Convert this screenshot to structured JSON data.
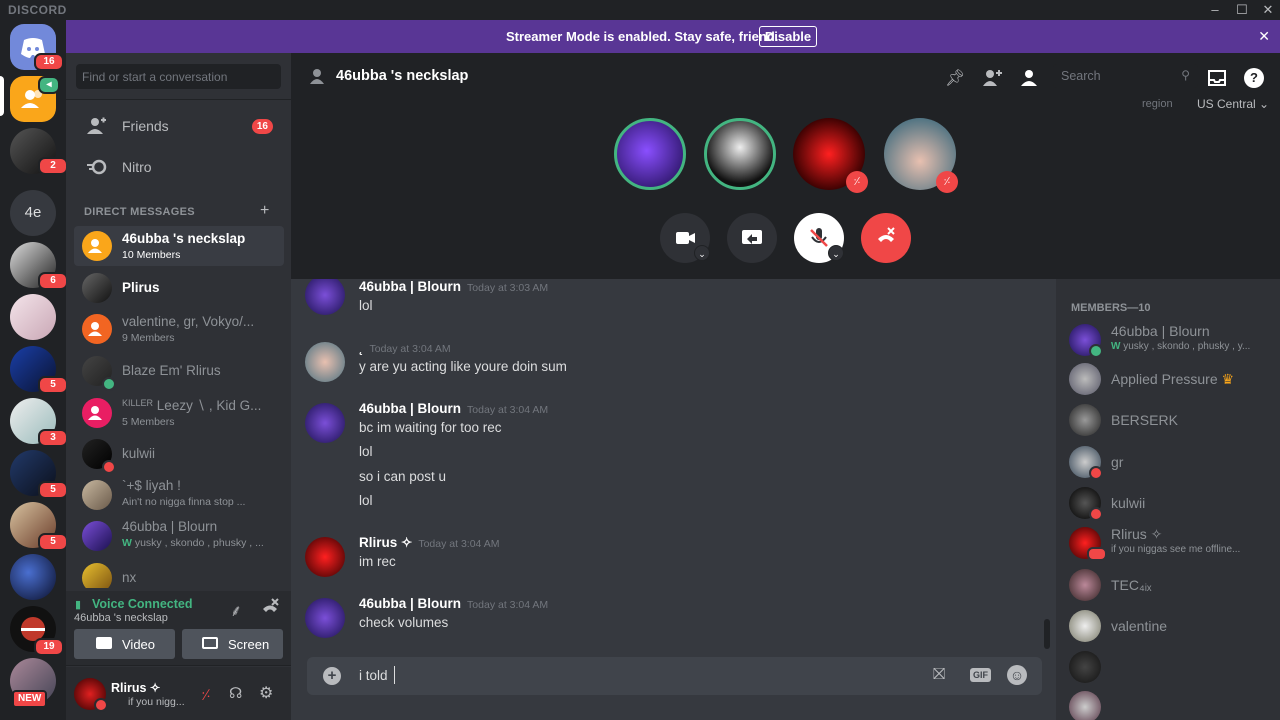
{
  "app": {
    "title": "DISCORD"
  },
  "window": {
    "min": "–",
    "max": "☐",
    "close": "✕"
  },
  "banner": {
    "text": "Streamer Mode is enabled. Stay safe, friend.",
    "button": "Disable",
    "close": "✕"
  },
  "guilds": {
    "items": [
      {
        "badge": "16"
      },
      {
        "badge": ""
      },
      {
        "badge": "2"
      },
      {
        "label": "4e",
        "badge": ""
      },
      {
        "badge": "6"
      },
      {
        "badge": ""
      },
      {
        "badge": "5"
      },
      {
        "badge": "3"
      },
      {
        "badge": "5"
      },
      {
        "badge": "5"
      },
      {
        "badge": ""
      },
      {
        "badge": "19"
      },
      {
        "badge": "NEW"
      }
    ]
  },
  "sidebar": {
    "search_placeholder": "Find or start a conversation",
    "friends": {
      "label": "Friends",
      "badge": "16"
    },
    "nitro": {
      "label": "Nitro"
    },
    "dm_header": "DIRECT MESSAGES",
    "dms": [
      {
        "name": "46ubba 's neckslap",
        "sub": "10 Members"
      },
      {
        "name": "Plirus",
        "sub": ""
      },
      {
        "name": "valentine, gr, Vokyo/...",
        "sub": "9 Members"
      },
      {
        "name": "Blaze Em' Rlirus",
        "sub": ""
      },
      {
        "name": "Leezy ∖ , Kid G...",
        "prefix": "KILLER",
        "sub": "5 Members"
      },
      {
        "name": "kulwii",
        "sub": ""
      },
      {
        "name": "`+$ liyah !",
        "sub": "Ain't no nigga finna stop ..."
      },
      {
        "name": "46ubba | Blourn",
        "sub": "yusky , skondo , phusky , ..."
      },
      {
        "name": "nx",
        "sub": ""
      }
    ],
    "voice": {
      "status": "Voice Connected",
      "channel": "46ubba 's neckslap",
      "video": "Video",
      "screen": "Screen"
    },
    "user": {
      "name": "Rlirus ✧",
      "status": "if you nigg..."
    }
  },
  "header": {
    "channel": "46ubba 's neckslap",
    "search_placeholder": "Search",
    "region_label": "region",
    "region_value": "US Central"
  },
  "messages": [
    {
      "author": "46ubba | Blourn",
      "time": "Today at 3:03 AM",
      "lines": [
        "lol"
      ]
    },
    {
      "author": "˛",
      "time": "Today at 3:04 AM",
      "lines": [
        "y are yu acting like youre doin sum"
      ]
    },
    {
      "author": "46ubba | Blourn",
      "time": "Today at 3:04 AM",
      "lines": [
        "bc im waiting for too rec",
        "lol",
        "so i can post u",
        "lol"
      ]
    },
    {
      "author": "Rlirus ✧",
      "time": "Today at 3:04 AM",
      "lines": [
        "im rec"
      ]
    },
    {
      "author": "46ubba | Blourn",
      "time": "Today at 3:04 AM",
      "lines": [
        "check volumes"
      ]
    }
  ],
  "composer": {
    "value": "i told"
  },
  "members": {
    "header": "MEMBERS—10",
    "items": [
      {
        "name": "46ubba | Blourn",
        "status": "yusky , skondo , phusky , y..."
      },
      {
        "name": "Applied Pressure",
        "status": ""
      },
      {
        "name": "BERSERK",
        "status": ""
      },
      {
        "name": "gr",
        "status": ""
      },
      {
        "name": "kulwii",
        "status": ""
      },
      {
        "name": "Rlirus ✧",
        "status": "if you niggas see me offline..."
      },
      {
        "name": "TEC₄ᵢₓ",
        "status": ""
      },
      {
        "name": "valentine",
        "status": ""
      },
      {
        "name": "",
        "status": ""
      },
      {
        "name": "",
        "status": ""
      }
    ]
  },
  "colors": {
    "blurple": "#7289da",
    "streamer": "#593695",
    "danger": "#f04747",
    "online": "#43b581"
  }
}
